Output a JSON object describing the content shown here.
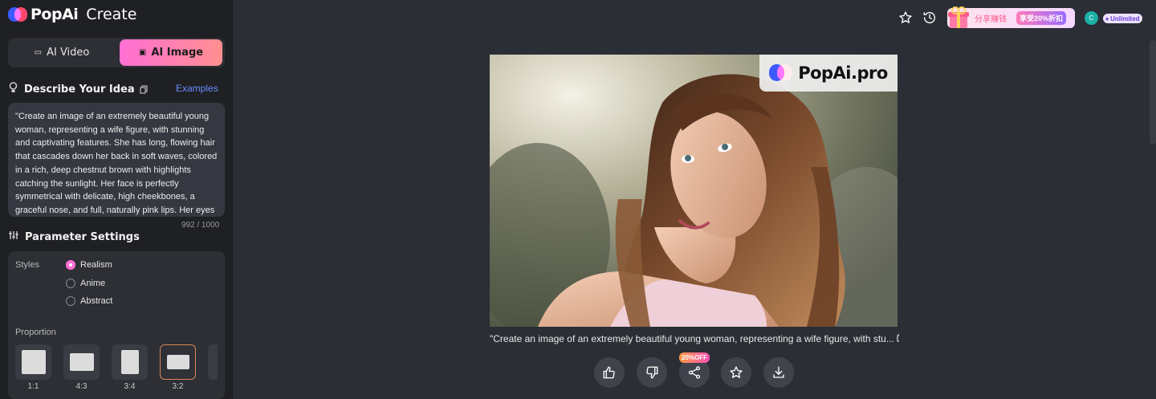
{
  "app": {
    "brand": "PopAi",
    "section": "Create"
  },
  "mode_toggle": {
    "video_label": "AI Video",
    "image_label": "AI Image",
    "active": "AI Image"
  },
  "describe": {
    "title": "Describe Your Idea",
    "examples_label": "Examples",
    "prompt": "\"Create an image of an extremely beautiful young woman, representing a wife figure, with stunning and captivating features. She has long, flowing hair that cascades down her back in soft waves, colored in a rich, deep chestnut brown with highlights catching the sunlight. Her face is perfectly symmetrical with delicate, high cheekbones, a graceful nose, and full, naturally pink lips. Her eyes are large, almond-",
    "counter": "992 / 1000"
  },
  "params": {
    "title": "Parameter Settings",
    "styles_label": "Styles",
    "styles": [
      "Realism",
      "Anime",
      "Abstract"
    ],
    "selected_style": "Realism",
    "proportion_label": "Proportion",
    "proportions": [
      "1:1",
      "4:3",
      "3:4",
      "3:2"
    ],
    "selected_proportion": "3:2"
  },
  "topbar": {
    "promo_text": "分享赚钱",
    "promo_badge": "享受20%折扣",
    "avatar_initial": "C",
    "plan_label": "Unlimited"
  },
  "result": {
    "watermark": "PopAi.pro",
    "caption": "\"Create an image of an extremely beautiful young woman, representing a wife figure, with stu...",
    "share_badge": "20%OFF"
  },
  "colors": {
    "accent_pink": "#ff6fd4",
    "link_blue": "#6b8cff",
    "sidebar_bg": "#1f2024",
    "main_bg": "#2b2e35"
  },
  "icons": [
    "bulb-icon",
    "copy-icon",
    "sliders-icon",
    "video-icon",
    "image-icon",
    "star-icon",
    "history-icon",
    "gift-icon",
    "thumbs-up-icon",
    "thumbs-down-icon",
    "share-icon",
    "download-icon"
  ]
}
